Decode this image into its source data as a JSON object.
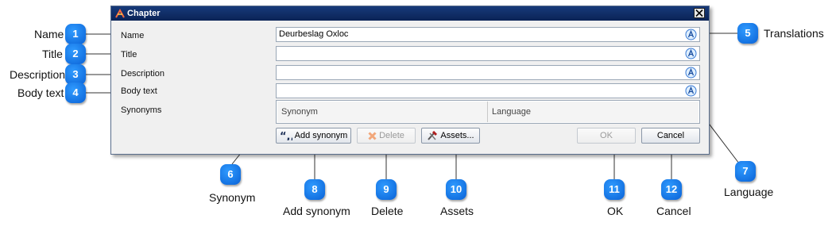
{
  "dialog": {
    "title": "Chapter",
    "close_label": "×"
  },
  "form": {
    "name_label": "Name",
    "name_value": "Deurbeslag Oxloc",
    "title_label": "Title",
    "title_value": "",
    "description_label": "Description",
    "description_value": "",
    "body_label": "Body text",
    "body_value": "",
    "synonyms_label": "Synonyms",
    "grid_columns": [
      "Synonym",
      "Language"
    ]
  },
  "buttons": {
    "add_synonym": "Add synonym",
    "delete": "Delete",
    "assets": "Assets...",
    "ok": "OK",
    "cancel": "Cancel"
  },
  "callouts": [
    {
      "num": "1",
      "text": "Name"
    },
    {
      "num": "2",
      "text": "Title"
    },
    {
      "num": "3",
      "text": "Description"
    },
    {
      "num": "4",
      "text": "Body text"
    },
    {
      "num": "5",
      "text": "Translations"
    },
    {
      "num": "6",
      "text": "Synonym"
    },
    {
      "num": "7",
      "text": "Language"
    },
    {
      "num": "8",
      "text": "Add synonym"
    },
    {
      "num": "9",
      "text": "Delete"
    },
    {
      "num": "10",
      "text": "Assets"
    },
    {
      "num": "11",
      "text": "OK"
    },
    {
      "num": "12",
      "text": "Cancel"
    }
  ],
  "icons": {
    "app": "chapter-app-icon",
    "translate": "translate-icon",
    "quote": "quote-icon",
    "delete": "delete-x-icon",
    "assets": "tools-icon"
  },
  "colors": {
    "badge": "#1a7ff0",
    "titlebar": "#0f2c66"
  }
}
